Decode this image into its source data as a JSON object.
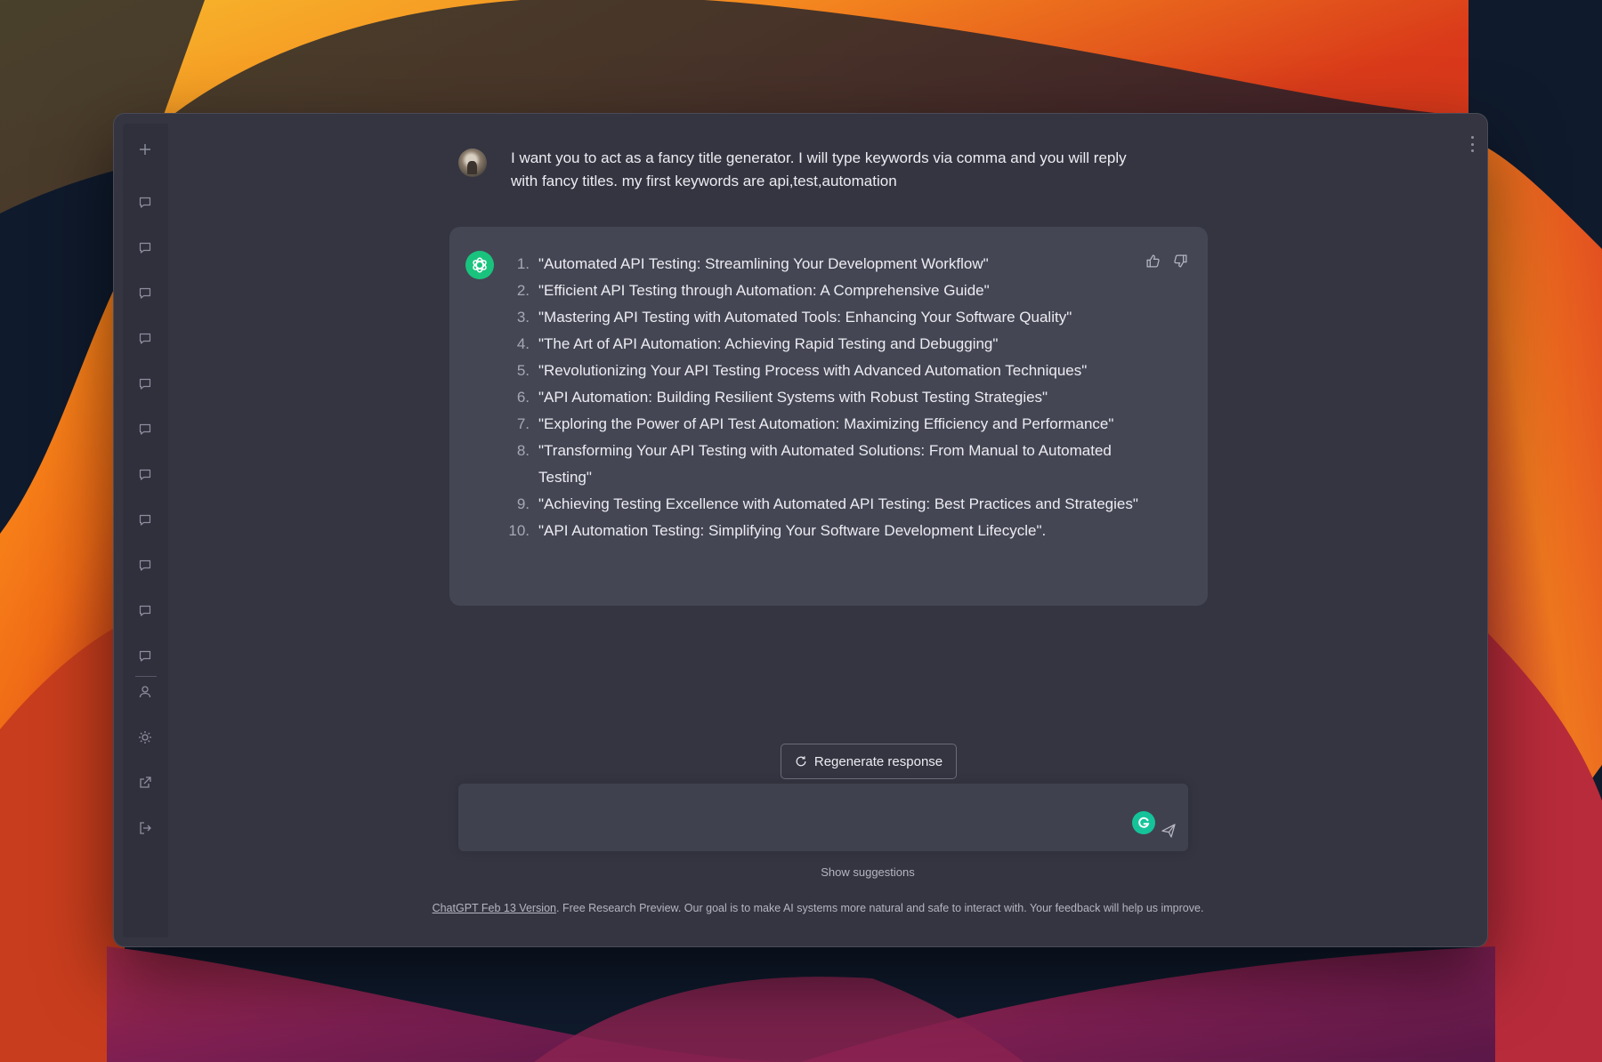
{
  "window": {
    "title": "ChatGPT"
  },
  "sidebar": {
    "new_chat_icon": "plus-icon",
    "conversation_icon": "chat-bubble-icon",
    "conversation_count": 11,
    "bottom_icons": [
      "user-icon",
      "sun-icon",
      "external-link-icon",
      "logout-icon"
    ]
  },
  "conversation": {
    "user_message": "I want you to act as a fancy title generator. I will type keywords via comma and you will reply with fancy titles. my first keywords are api,test,automation",
    "assistant_titles": [
      {
        "num": "1.",
        "text": "\"Automated API Testing: Streamlining Your Development Workflow\""
      },
      {
        "num": "2.",
        "text": "\"Efficient API Testing through Automation: A Comprehensive Guide\""
      },
      {
        "num": "3.",
        "text": "\"Mastering API Testing with Automated Tools: Enhancing Your Software Quality\""
      },
      {
        "num": "4.",
        "text": "\"The Art of API Automation: Achieving Rapid Testing and Debugging\""
      },
      {
        "num": "5.",
        "text": "\"Revolutionizing Your API Testing Process with Advanced Automation Techniques\""
      },
      {
        "num": "6.",
        "text": "\"API Automation: Building Resilient Systems with Robust Testing Strategies\""
      },
      {
        "num": "7.",
        "text": "\"Exploring the Power of API Test Automation: Maximizing Efficiency and Performance\""
      },
      {
        "num": "8.",
        "text": "\"Transforming Your API Testing with Automated Solutions: From Manual to Automated Testing\""
      },
      {
        "num": "9.",
        "text": "\"Achieving Testing Excellence with Automated API Testing: Best Practices and Strategies\""
      },
      {
        "num": "10.",
        "text": "\"API Automation Testing: Simplifying Your Software Development Lifecycle\"."
      }
    ]
  },
  "actions": {
    "regenerate_label": "Regenerate response",
    "composer_value": "",
    "show_suggestions": "Show suggestions"
  },
  "footer": {
    "version_link": "ChatGPT Feb 13 Version",
    "text": ". Free Research Preview. Our goal is to make AI systems more natural and safe to interact with. Your feedback will help us improve."
  },
  "colors": {
    "window_bg": "#343541",
    "sidebar_bg": "#2f303b",
    "assistant_bg": "#444654",
    "composer_bg": "#40414f",
    "brand_green": "#19c37d",
    "grammarly_green": "#15c39a",
    "text_primary": "#ececf1",
    "text_muted": "#b4b5c0"
  }
}
